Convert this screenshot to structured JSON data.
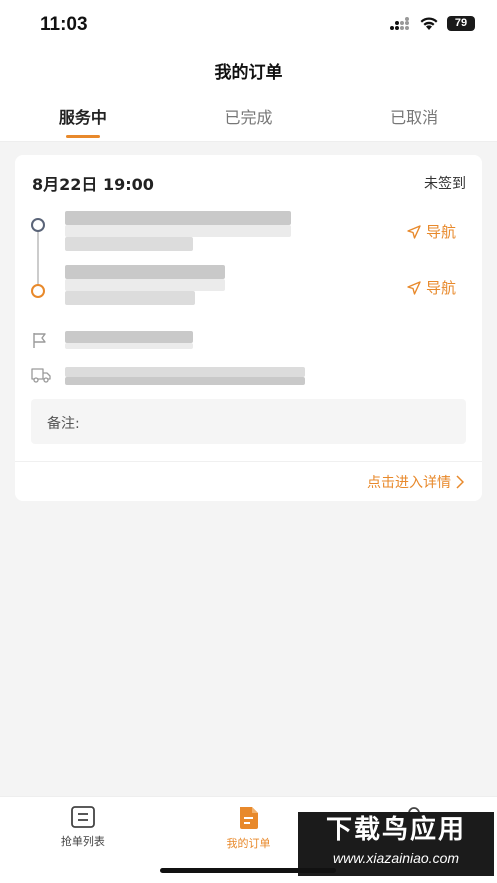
{
  "status_bar": {
    "time": "11:03",
    "battery": "79"
  },
  "header": {
    "title": "我的订单"
  },
  "tabs": [
    {
      "label": "服务中",
      "active": true
    },
    {
      "label": "已完成",
      "active": false
    },
    {
      "label": "已取消",
      "active": false
    }
  ],
  "order": {
    "datetime": "8月22日 19:00",
    "status": "未签到",
    "navigate_label": "导航",
    "remark_label": "备注:",
    "detail_link": "点击进入详情"
  },
  "tab_bar": {
    "items": [
      {
        "label": "抢单列表",
        "icon": "list-icon",
        "active": false
      },
      {
        "label": "我的订单",
        "icon": "order-doc-icon",
        "active": true
      },
      {
        "label": "",
        "icon": "user-icon",
        "active": false
      }
    ]
  },
  "watermark": {
    "title": "下载鸟应用",
    "url": "www.xiazainiao.com"
  },
  "colors": {
    "accent": "#e8892b",
    "start_dot": "#5a6478",
    "background": "#f4f4f4"
  }
}
